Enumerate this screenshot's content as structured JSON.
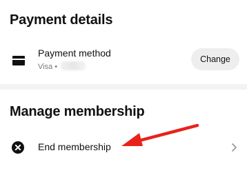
{
  "payment": {
    "title": "Payment details",
    "method_label": "Payment method",
    "method_sub": "Visa •",
    "change_label": "Change"
  },
  "membership": {
    "title": "Manage membership",
    "end_label": "End membership"
  },
  "colors": {
    "annotation_arrow": "#e8221b",
    "divider": "#f3f3f3",
    "button_bg": "#eeeeee"
  },
  "icons": {
    "card": "credit-card-icon",
    "end": "close-circle-icon",
    "chevron": "chevron-right-icon",
    "arrow": "annotation-arrow-icon"
  }
}
